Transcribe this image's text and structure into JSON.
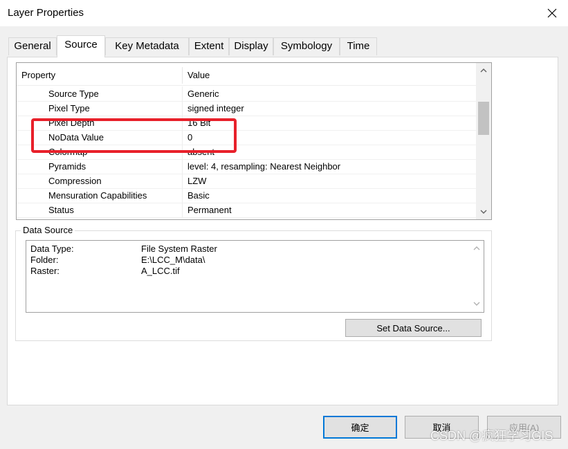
{
  "window": {
    "title": "Layer Properties",
    "close_label": "✕"
  },
  "tabs": [
    {
      "label": "General"
    },
    {
      "label": "Source",
      "active": true
    },
    {
      "label": "Key Metadata"
    },
    {
      "label": "Extent"
    },
    {
      "label": "Display"
    },
    {
      "label": "Symbology"
    },
    {
      "label": "Time"
    }
  ],
  "property_grid": {
    "header_property": "Property",
    "header_value": "Value",
    "rows": [
      {
        "property": "Source Type",
        "value": "Generic"
      },
      {
        "property": "Pixel Type",
        "value": "signed integer"
      },
      {
        "property": "Pixel Depth",
        "value": "16 Bit"
      },
      {
        "property": "NoData Value",
        "value": "0"
      },
      {
        "property": "Colormap",
        "value": "absent"
      },
      {
        "property": "Pyramids",
        "value": "level: 4, resampling: Nearest Neighbor"
      },
      {
        "property": "Compression",
        "value": "LZW"
      },
      {
        "property": "Mensuration Capabilities",
        "value": "Basic"
      },
      {
        "property": "Status",
        "value": "Permanent"
      }
    ]
  },
  "data_source": {
    "legend": "Data Source",
    "lines": [
      {
        "key": "Data Type:",
        "value": "File System Raster"
      },
      {
        "key": "Folder:",
        "value": "E:\\LCC_M\\data\\"
      },
      {
        "key": "Raster:",
        "value": "A_LCC.tif"
      }
    ],
    "set_button": "Set Data Source..."
  },
  "buttons": {
    "ok": "确定",
    "cancel": "取消",
    "apply": "应用(A)"
  },
  "watermark": "CSDN @疯狂学习GIS",
  "colors": {
    "highlight": "#e8202a",
    "ok_border": "#0078d7"
  }
}
